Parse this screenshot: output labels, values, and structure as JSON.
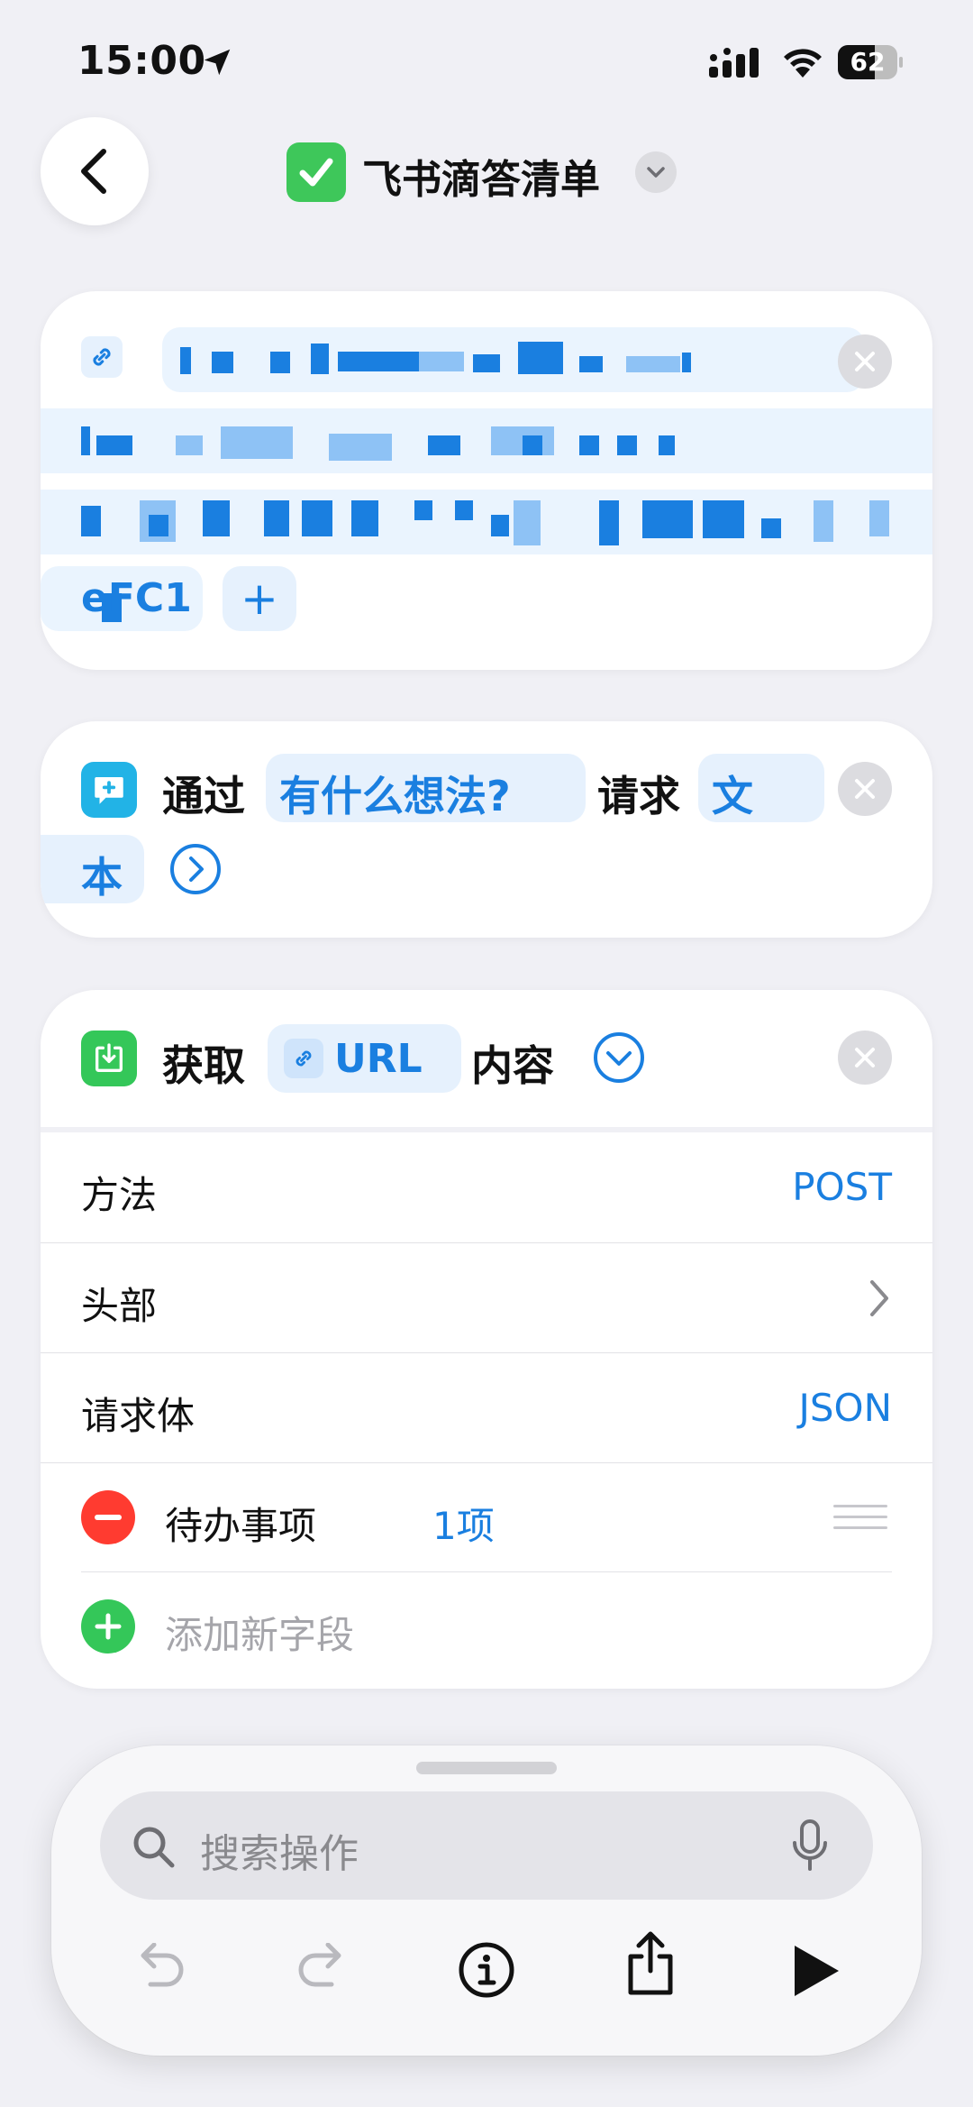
{
  "status_bar": {
    "time": "15:00",
    "battery": "62",
    "battery_level": 0.62
  },
  "nav": {
    "title": "飞书滴答清单"
  },
  "card_url": {
    "text_tail": "eFC1",
    "add_button": "+"
  },
  "card_ask": {
    "prefix": "通过",
    "prompt": "有什么想法?",
    "middle": "请求",
    "type_part1": "文",
    "type_part2": "本"
  },
  "card_fetch": {
    "verb": "获取",
    "url_token": "URL",
    "suffix": "内容",
    "rows": {
      "method": {
        "label": "方法",
        "value": "POST"
      },
      "headers": {
        "label": "头部"
      },
      "body": {
        "label": "请求体",
        "value": "JSON"
      }
    },
    "field": {
      "name": "待办事项",
      "value": "1项"
    },
    "add_field": "添加新字段"
  },
  "bottom": {
    "search_placeholder": "搜索操作"
  },
  "colors": {
    "accent": "#1a7fe0",
    "green": "#34c759",
    "red": "#ff3b30",
    "app_icon": "#3ec75a"
  }
}
